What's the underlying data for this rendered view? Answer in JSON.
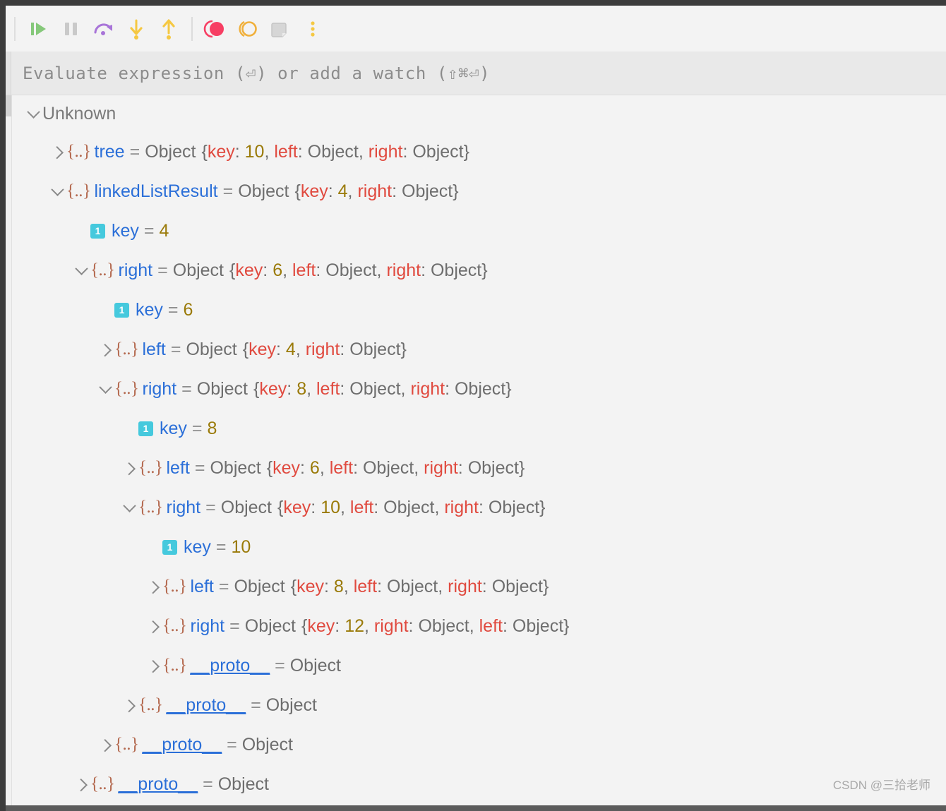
{
  "window": {
    "frame_color": "#3c3c3c",
    "panel_bg": "#f3f3f3"
  },
  "toolbar": {
    "buttons": [
      {
        "name": "resume-program-button",
        "icon": "resume-play-icon",
        "label": "Resume Program",
        "color": "#85c87a"
      },
      {
        "name": "pause-program-button",
        "icon": "pause-icon",
        "label": "Pause Program",
        "color": "#c9c9c9"
      },
      {
        "name": "step-over-button",
        "icon": "step-over-arc-icon",
        "label": "Step Over",
        "color": "#a874d8"
      },
      {
        "name": "step-into-button",
        "icon": "step-into-down-arrow-icon",
        "label": "Step Into",
        "color": "#f5c842"
      },
      {
        "name": "step-out-button",
        "icon": "step-out-up-arrow-icon",
        "label": "Step Out",
        "color": "#f5c842"
      },
      {
        "name": "stop-button",
        "icon": "stop-record-circle-icon",
        "label": "Stop",
        "color": "#f73e63"
      },
      {
        "name": "mute-breakpoints-button",
        "icon": "mute-breakpoints-ring-icon",
        "label": "Mute Breakpoints",
        "color": "#f0b03c"
      },
      {
        "name": "restore-layout-button",
        "icon": "restore-layout-page-icon",
        "label": "Restore Layout",
        "color": "#c9c9c9"
      },
      {
        "name": "more-options-button",
        "icon": "vertical-dots-icon",
        "label": "More",
        "color": "#f5c842"
      }
    ]
  },
  "evaluate_bar": {
    "placeholder": "Evaluate expression (⏎) or add a watch (⇧⌘⏎)"
  },
  "tree": {
    "root_label": "Unknown",
    "rows": [
      {
        "indent": 1,
        "twisty": "right",
        "icon": "object",
        "name": "tree",
        "eq": "=",
        "type": "Object",
        "preview": [
          {
            "t": "brace",
            "v": "{"
          },
          {
            "t": "key",
            "v": "key"
          },
          {
            "t": "punc",
            "v": ": "
          },
          {
            "t": "num",
            "v": "10"
          },
          {
            "t": "punc",
            "v": ", "
          },
          {
            "t": "key",
            "v": "left"
          },
          {
            "t": "punc",
            "v": ": "
          },
          {
            "t": "obj",
            "v": "Object"
          },
          {
            "t": "punc",
            "v": ", "
          },
          {
            "t": "key",
            "v": "right"
          },
          {
            "t": "punc",
            "v": ": "
          },
          {
            "t": "obj",
            "v": "Object"
          },
          {
            "t": "brace",
            "v": "}"
          }
        ]
      },
      {
        "indent": 1,
        "twisty": "down",
        "icon": "object",
        "name": "linkedListResult",
        "eq": "=",
        "type": "Object",
        "preview": [
          {
            "t": "brace",
            "v": "{"
          },
          {
            "t": "key",
            "v": "key"
          },
          {
            "t": "punc",
            "v": ": "
          },
          {
            "t": "num",
            "v": "4"
          },
          {
            "t": "punc",
            "v": ", "
          },
          {
            "t": "key",
            "v": "right"
          },
          {
            "t": "punc",
            "v": ": "
          },
          {
            "t": "obj",
            "v": "Object"
          },
          {
            "t": "brace",
            "v": "}"
          }
        ]
      },
      {
        "indent": 2,
        "twisty": "none",
        "icon": "number",
        "name": "key",
        "eq": "=",
        "type": "",
        "value": "4",
        "value_kind": "num",
        "preview": []
      },
      {
        "indent": 2,
        "twisty": "down",
        "icon": "object",
        "name": "right",
        "eq": "=",
        "type": "Object",
        "preview": [
          {
            "t": "brace",
            "v": "{"
          },
          {
            "t": "key",
            "v": "key"
          },
          {
            "t": "punc",
            "v": ": "
          },
          {
            "t": "num",
            "v": "6"
          },
          {
            "t": "punc",
            "v": ", "
          },
          {
            "t": "key",
            "v": "left"
          },
          {
            "t": "punc",
            "v": ": "
          },
          {
            "t": "obj",
            "v": "Object"
          },
          {
            "t": "punc",
            "v": ", "
          },
          {
            "t": "key",
            "v": "right"
          },
          {
            "t": "punc",
            "v": ": "
          },
          {
            "t": "obj",
            "v": "Object"
          },
          {
            "t": "brace",
            "v": "}"
          }
        ]
      },
      {
        "indent": 3,
        "twisty": "none",
        "icon": "number",
        "name": "key",
        "eq": "=",
        "type": "",
        "value": "6",
        "value_kind": "num",
        "preview": []
      },
      {
        "indent": 3,
        "twisty": "right",
        "icon": "object",
        "name": "left",
        "eq": "=",
        "type": "Object",
        "preview": [
          {
            "t": "brace",
            "v": "{"
          },
          {
            "t": "key",
            "v": "key"
          },
          {
            "t": "punc",
            "v": ": "
          },
          {
            "t": "num",
            "v": "4"
          },
          {
            "t": "punc",
            "v": ", "
          },
          {
            "t": "key",
            "v": "right"
          },
          {
            "t": "punc",
            "v": ": "
          },
          {
            "t": "obj",
            "v": "Object"
          },
          {
            "t": "brace",
            "v": "}"
          }
        ]
      },
      {
        "indent": 3,
        "twisty": "down",
        "icon": "object",
        "name": "right",
        "eq": "=",
        "type": "Object",
        "preview": [
          {
            "t": "brace",
            "v": "{"
          },
          {
            "t": "key",
            "v": "key"
          },
          {
            "t": "punc",
            "v": ": "
          },
          {
            "t": "num",
            "v": "8"
          },
          {
            "t": "punc",
            "v": ", "
          },
          {
            "t": "key",
            "v": "left"
          },
          {
            "t": "punc",
            "v": ": "
          },
          {
            "t": "obj",
            "v": "Object"
          },
          {
            "t": "punc",
            "v": ", "
          },
          {
            "t": "key",
            "v": "right"
          },
          {
            "t": "punc",
            "v": ": "
          },
          {
            "t": "obj",
            "v": "Object"
          },
          {
            "t": "brace",
            "v": "}"
          }
        ]
      },
      {
        "indent": 4,
        "twisty": "none",
        "icon": "number",
        "name": "key",
        "eq": "=",
        "type": "",
        "value": "8",
        "value_kind": "num",
        "preview": []
      },
      {
        "indent": 4,
        "twisty": "right",
        "icon": "object",
        "name": "left",
        "eq": "=",
        "type": "Object",
        "preview": [
          {
            "t": "brace",
            "v": "{"
          },
          {
            "t": "key",
            "v": "key"
          },
          {
            "t": "punc",
            "v": ": "
          },
          {
            "t": "num",
            "v": "6"
          },
          {
            "t": "punc",
            "v": ", "
          },
          {
            "t": "key",
            "v": "left"
          },
          {
            "t": "punc",
            "v": ": "
          },
          {
            "t": "obj",
            "v": "Object"
          },
          {
            "t": "punc",
            "v": ", "
          },
          {
            "t": "key",
            "v": "right"
          },
          {
            "t": "punc",
            "v": ": "
          },
          {
            "t": "obj",
            "v": "Object"
          },
          {
            "t": "brace",
            "v": "}"
          }
        ]
      },
      {
        "indent": 4,
        "twisty": "down",
        "icon": "object",
        "name": "right",
        "eq": "=",
        "type": "Object",
        "preview": [
          {
            "t": "brace",
            "v": "{"
          },
          {
            "t": "key",
            "v": "key"
          },
          {
            "t": "punc",
            "v": ": "
          },
          {
            "t": "num",
            "v": "10"
          },
          {
            "t": "punc",
            "v": ", "
          },
          {
            "t": "key",
            "v": "left"
          },
          {
            "t": "punc",
            "v": ": "
          },
          {
            "t": "obj",
            "v": "Object"
          },
          {
            "t": "punc",
            "v": ", "
          },
          {
            "t": "key",
            "v": "right"
          },
          {
            "t": "punc",
            "v": ": "
          },
          {
            "t": "obj",
            "v": "Object"
          },
          {
            "t": "brace",
            "v": "}"
          }
        ]
      },
      {
        "indent": 5,
        "twisty": "none",
        "icon": "number",
        "name": "key",
        "eq": "=",
        "type": "",
        "value": "10",
        "value_kind": "num",
        "preview": []
      },
      {
        "indent": 5,
        "twisty": "right",
        "icon": "object",
        "name": "left",
        "eq": "=",
        "type": "Object",
        "preview": [
          {
            "t": "brace",
            "v": "{"
          },
          {
            "t": "key",
            "v": "key"
          },
          {
            "t": "punc",
            "v": ": "
          },
          {
            "t": "num",
            "v": "8"
          },
          {
            "t": "punc",
            "v": ", "
          },
          {
            "t": "key",
            "v": "left"
          },
          {
            "t": "punc",
            "v": ": "
          },
          {
            "t": "obj",
            "v": "Object"
          },
          {
            "t": "punc",
            "v": ", "
          },
          {
            "t": "key",
            "v": "right"
          },
          {
            "t": "punc",
            "v": ": "
          },
          {
            "t": "obj",
            "v": "Object"
          },
          {
            "t": "brace",
            "v": "}"
          }
        ]
      },
      {
        "indent": 5,
        "twisty": "right",
        "icon": "object",
        "name": "right",
        "eq": "=",
        "type": "Object",
        "preview": [
          {
            "t": "brace",
            "v": "{"
          },
          {
            "t": "key",
            "v": "key"
          },
          {
            "t": "punc",
            "v": ": "
          },
          {
            "t": "num",
            "v": "12"
          },
          {
            "t": "punc",
            "v": ", "
          },
          {
            "t": "key",
            "v": "right"
          },
          {
            "t": "punc",
            "v": ": "
          },
          {
            "t": "obj",
            "v": "Object"
          },
          {
            "t": "punc",
            "v": ", "
          },
          {
            "t": "key",
            "v": "left"
          },
          {
            "t": "punc",
            "v": ": "
          },
          {
            "t": "obj",
            "v": "Object"
          },
          {
            "t": "brace",
            "v": "}"
          }
        ]
      },
      {
        "indent": 5,
        "twisty": "right",
        "icon": "object",
        "name": "__proto__",
        "proto": true,
        "eq": "=",
        "type": "Object",
        "preview": []
      },
      {
        "indent": 4,
        "twisty": "right",
        "icon": "object",
        "name": "__proto__",
        "proto": true,
        "eq": "=",
        "type": "Object",
        "preview": []
      },
      {
        "indent": 3,
        "twisty": "right",
        "icon": "object",
        "name": "__proto__",
        "proto": true,
        "eq": "=",
        "type": "Object",
        "preview": []
      },
      {
        "indent": 2,
        "twisty": "right",
        "icon": "object",
        "name": "__proto__",
        "proto": true,
        "eq": "=",
        "type": "Object",
        "preview": []
      }
    ]
  },
  "watermark": {
    "text": "CSDN @三拾老师"
  },
  "colors": {
    "varname": "#2b6fd8",
    "key": "#e04a3f",
    "number": "#9a7a08",
    "type": "#6e6e6e",
    "object_icon": "#b4694f",
    "number_icon_bg": "#45c9dd"
  }
}
